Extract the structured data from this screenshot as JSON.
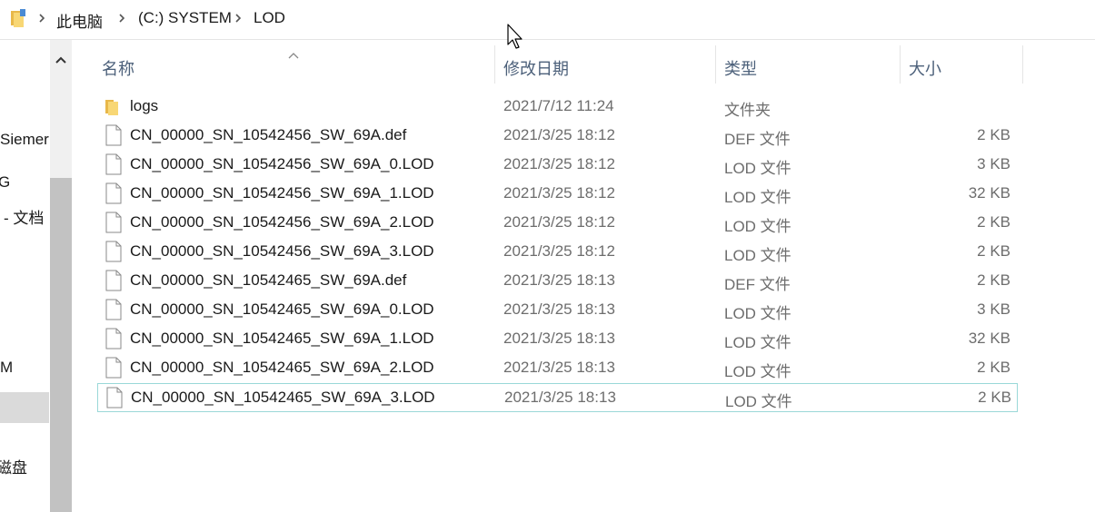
{
  "breadcrumb": {
    "items": [
      "此电脑",
      "(C:) SYSTEM",
      "LOD"
    ]
  },
  "nav_pane": {
    "items": [
      "Siemer",
      "G",
      "- 文档",
      "M",
      "磁盘"
    ],
    "selected_index": 3
  },
  "columns": {
    "name": "名称",
    "date": "修改日期",
    "type": "类型",
    "size": "大小"
  },
  "files": [
    {
      "name": "logs",
      "date": "2021/7/12 11:24",
      "type": "文件夹",
      "size": "",
      "icon": "folder-icon"
    },
    {
      "name": "CN_00000_SN_10542456_SW_69A.def",
      "date": "2021/3/25 18:12",
      "type": "DEF 文件",
      "size": "2 KB",
      "icon": "file-icon"
    },
    {
      "name": "CN_00000_SN_10542456_SW_69A_0.LOD",
      "date": "2021/3/25 18:12",
      "type": "LOD 文件",
      "size": "3 KB",
      "icon": "file-icon"
    },
    {
      "name": "CN_00000_SN_10542456_SW_69A_1.LOD",
      "date": "2021/3/25 18:12",
      "type": "LOD 文件",
      "size": "32 KB",
      "icon": "file-icon"
    },
    {
      "name": "CN_00000_SN_10542456_SW_69A_2.LOD",
      "date": "2021/3/25 18:12",
      "type": "LOD 文件",
      "size": "2 KB",
      "icon": "file-icon"
    },
    {
      "name": "CN_00000_SN_10542456_SW_69A_3.LOD",
      "date": "2021/3/25 18:12",
      "type": "LOD 文件",
      "size": "2 KB",
      "icon": "file-icon"
    },
    {
      "name": "CN_00000_SN_10542465_SW_69A.def",
      "date": "2021/3/25 18:13",
      "type": "DEF 文件",
      "size": "2 KB",
      "icon": "file-icon"
    },
    {
      "name": "CN_00000_SN_10542465_SW_69A_0.LOD",
      "date": "2021/3/25 18:13",
      "type": "LOD 文件",
      "size": "3 KB",
      "icon": "file-icon"
    },
    {
      "name": "CN_00000_SN_10542465_SW_69A_1.LOD",
      "date": "2021/3/25 18:13",
      "type": "LOD 文件",
      "size": "32 KB",
      "icon": "file-icon"
    },
    {
      "name": "CN_00000_SN_10542465_SW_69A_2.LOD",
      "date": "2021/3/25 18:13",
      "type": "LOD 文件",
      "size": "2 KB",
      "icon": "file-icon"
    },
    {
      "name": "CN_00000_SN_10542465_SW_69A_3.LOD",
      "date": "2021/3/25 18:13",
      "type": "LOD 文件",
      "size": "2 KB",
      "icon": "file-icon"
    }
  ],
  "focused_index": 10,
  "colors": {
    "header_text": "#4c607a",
    "meta_text": "#6d6d6d",
    "focus_border": "#9ad8d8",
    "folder_yellow": "#f8d775",
    "nav_selected": "#dadada"
  }
}
